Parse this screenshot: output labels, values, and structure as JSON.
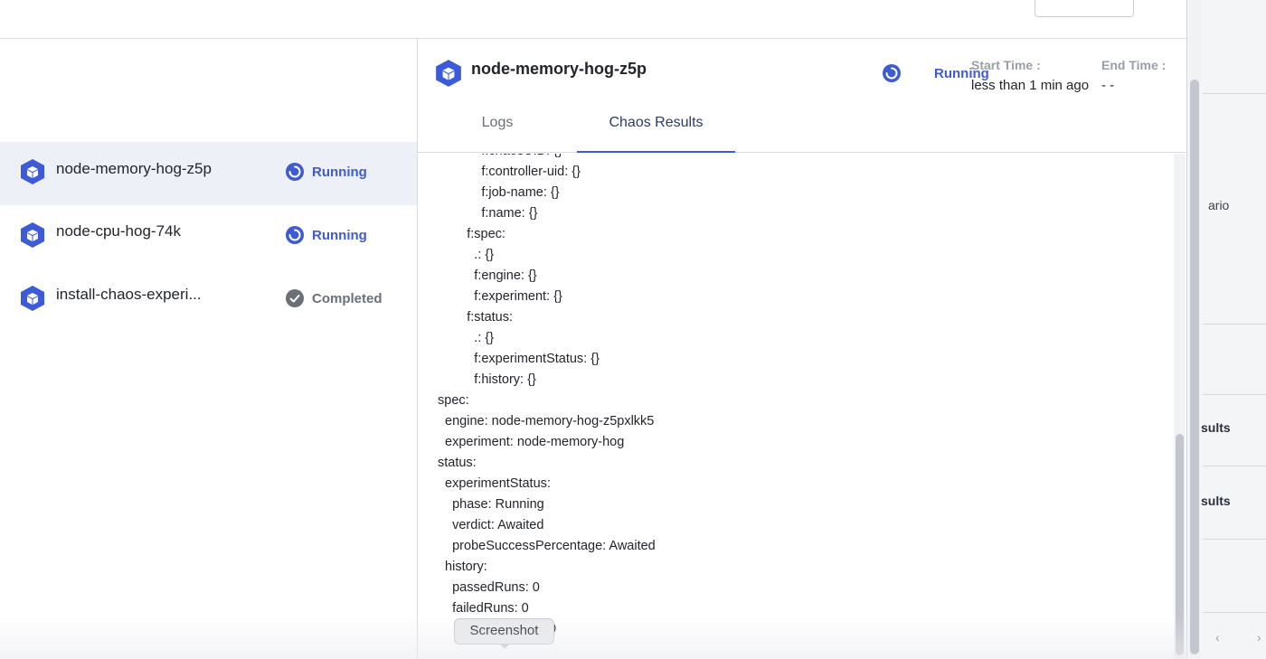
{
  "background": {
    "partial_text_1": "ario",
    "partial_text_2": "sults",
    "partial_text_3": "sults"
  },
  "left_list": {
    "items": [
      {
        "name": "node-memory-hog-z5p",
        "status": "Running"
      },
      {
        "name": "node-cpu-hog-74k",
        "status": "Running"
      },
      {
        "name": "install-chaos-experi...",
        "status": "Completed"
      }
    ]
  },
  "header": {
    "title": "node-memory-hog-z5p",
    "status": "Running",
    "start_time_label": "Start Time :",
    "start_time_value": "less than 1 min ago",
    "end_time_label": "End Time :",
    "end_time_value": "- -"
  },
  "tabs": {
    "logs": "Logs",
    "chaos_results": "Chaos Results"
  },
  "yaml_lines": [
    "            f:chaosUID: {}",
    "            f:controller-uid: {}",
    "            f:job-name: {}",
    "            f:name: {}",
    "        f:spec:",
    "          .: {}",
    "          f:engine: {}",
    "          f:experiment: {}",
    "        f:status:",
    "          .: {}",
    "          f:experimentStatus: {}",
    "          f:history: {}",
    "spec:",
    "  engine: node-memory-hog-z5pxlkk5",
    "  experiment: node-memory-hog",
    "status:",
    "  experimentStatus:",
    "    phase: Running",
    "    verdict: Awaited",
    "    probeSuccessPercentage: Awaited",
    "  history:",
    "    passedRuns: 0",
    "    failedRuns: 0"
  ],
  "tooltip": "Screenshot",
  "tooltip_trailing": "0",
  "colors": {
    "accent": "#3f5bd0",
    "hex_icon": "#3d5bd6",
    "completed": "#6b6f78",
    "active_row": "#eef0f8"
  }
}
